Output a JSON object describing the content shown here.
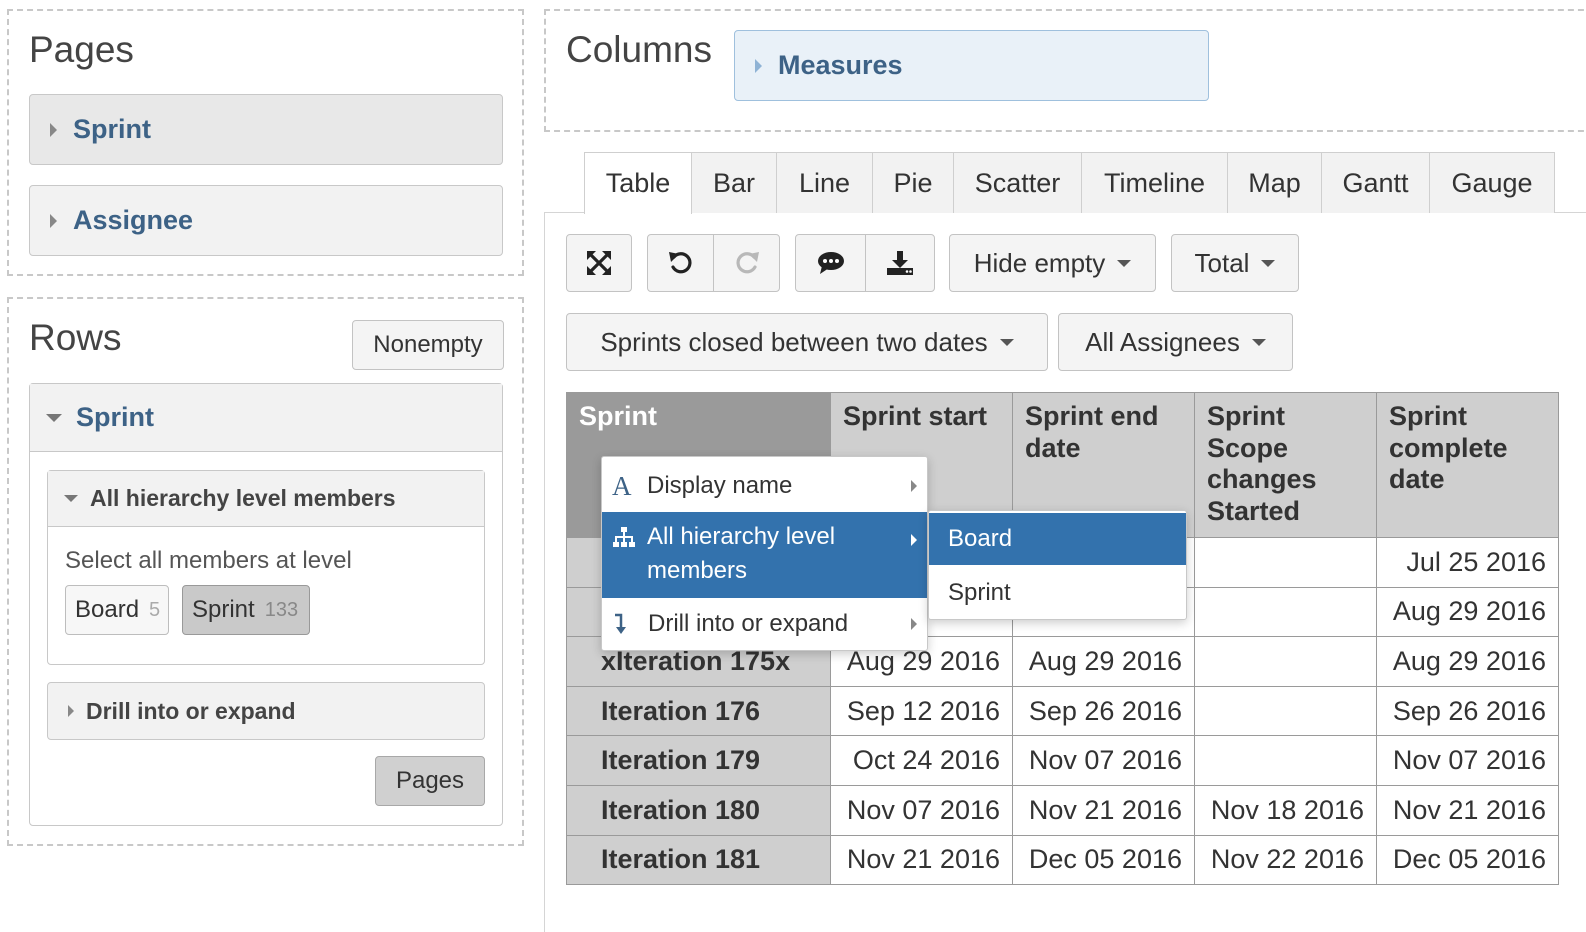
{
  "pages_panel": {
    "title": "Pages",
    "items": [
      {
        "label": "Sprint"
      },
      {
        "label": "Assignee"
      }
    ]
  },
  "rows_panel": {
    "title": "Rows",
    "nonempty_button": "Nonempty",
    "dimension": "Sprint",
    "hierarchy_section": {
      "label": "All hierarchy level members",
      "hint": "Select all members at level",
      "levels": [
        {
          "label": "Board",
          "count": "5"
        },
        {
          "label": "Sprint",
          "count": "133"
        }
      ]
    },
    "drill_section": {
      "label": "Drill into or expand"
    },
    "pages_button": "Pages"
  },
  "columns_panel": {
    "title": "Columns",
    "measures_label": "Measures"
  },
  "tabs": [
    "Table",
    "Bar",
    "Line",
    "Pie",
    "Scatter",
    "Timeline",
    "Map",
    "Gantt",
    "Gauge"
  ],
  "active_tab": "Table",
  "toolbar": {
    "hide_empty": "Hide empty",
    "total": "Total",
    "filter_sprints": "Sprints closed between two dates",
    "filter_assignees": "All Assignees",
    "icons": [
      "fullscreen-icon",
      "undo-icon",
      "redo-icon",
      "comment-icon",
      "download-icon"
    ]
  },
  "table": {
    "headers": {
      "h0": "Sprint",
      "h1": "Sprint start",
      "h2": "Sprint end date",
      "h3": "Sprint Scope changes Started",
      "h4": "Sprint complete date"
    },
    "rows": [
      {
        "name": "",
        "start": "",
        "end": "",
        "scope": "",
        "complete": "Jul 25 2016"
      },
      {
        "name": "",
        "start": "",
        "end": "",
        "scope": "",
        "complete": "Aug 29 2016"
      },
      {
        "name": "xIteration 175x",
        "start": "Aug 29 2016",
        "end": "Aug 29 2016",
        "scope": "",
        "complete": "Aug 29 2016"
      },
      {
        "name": "Iteration 176",
        "start": "Sep 12 2016",
        "end": "Sep 26 2016",
        "scope": "",
        "complete": "Sep 26 2016"
      },
      {
        "name": "Iteration 179",
        "start": "Oct 24 2016",
        "end": "Nov 07 2016",
        "scope": "",
        "complete": "Nov 07 2016"
      },
      {
        "name": "Iteration 180",
        "start": "Nov 07 2016",
        "end": "Nov 21 2016",
        "scope": "Nov 18 2016",
        "complete": "Nov 21 2016"
      },
      {
        "name": "Iteration 181",
        "start": "Nov 21 2016",
        "end": "Dec 05 2016",
        "scope": "Nov 22 2016",
        "complete": "Dec 05 2016"
      }
    ]
  },
  "context_menu": {
    "items": [
      {
        "label": "Display name"
      },
      {
        "label": "All hierarchy level members"
      },
      {
        "label": "Drill into or expand"
      }
    ],
    "submenu": [
      {
        "label": "Board"
      },
      {
        "label": "Sprint"
      }
    ]
  },
  "colors": {
    "accent_blue": "#3372ad",
    "label_blue": "#3d6286",
    "header_dark": "#9a9a9a",
    "header_light": "#cfcfcf"
  }
}
